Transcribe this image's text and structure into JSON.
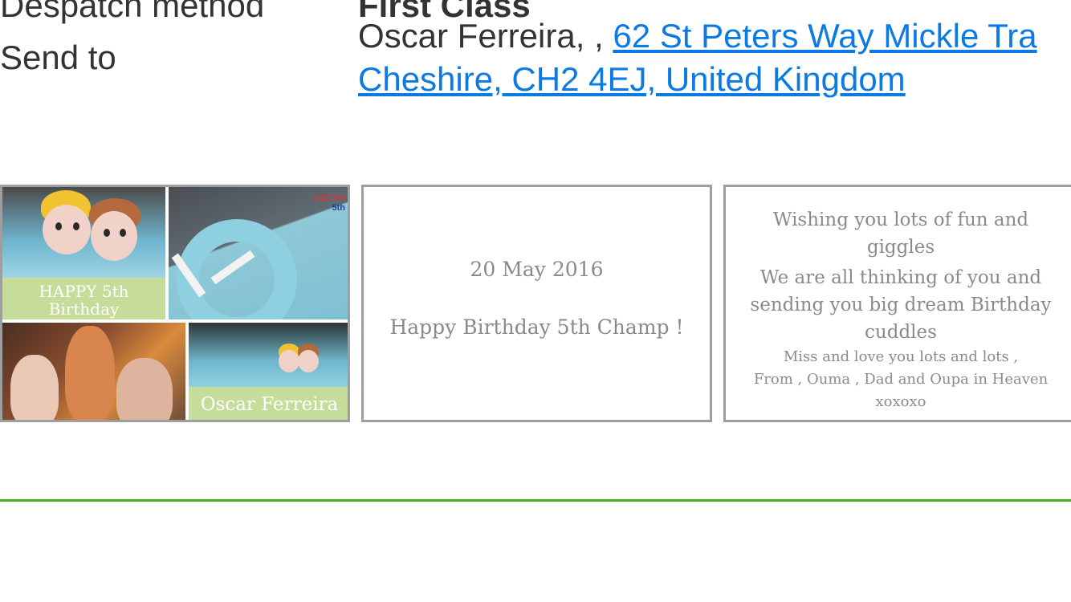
{
  "order": {
    "dispatch_label": "Despatch method",
    "dispatch_value": "First Class",
    "send_to_label": "Send to",
    "recipient_name": "Oscar Ferreira, ,",
    "address_line1": "62 St Peters Way Mickle Tra",
    "address_line2": "Cheshire, CH2 4EJ, United Kingdom"
  },
  "card": {
    "photo_panel": {
      "caption_top_line1": "HAPPY 5th",
      "caption_top_line2": "Birthday",
      "caption_bottom": "Oscar Ferreira",
      "cake_text_line1": "OSCAR",
      "cake_text_line2": "5th"
    },
    "date_panel": {
      "date": "20 May 2016",
      "title": "Happy Birthday 5th Champ !"
    },
    "message_panel": {
      "line1": "Wishing you lots of fun and",
      "line2": "giggles",
      "line3": "We are all thinking of you and",
      "line4": "sending you big dream Birthday",
      "line5": "cuddles",
      "line6": "Miss and love you lots and lots ,",
      "line7": "From , Ouma , Dad and Oupa in Heaven",
      "line8": "xoxoxo"
    }
  },
  "colors": {
    "link": "#0b7ae3",
    "divider": "#4aad1e",
    "panel_border": "#9e9e9e",
    "caption_bg": "#c6dc9b"
  }
}
